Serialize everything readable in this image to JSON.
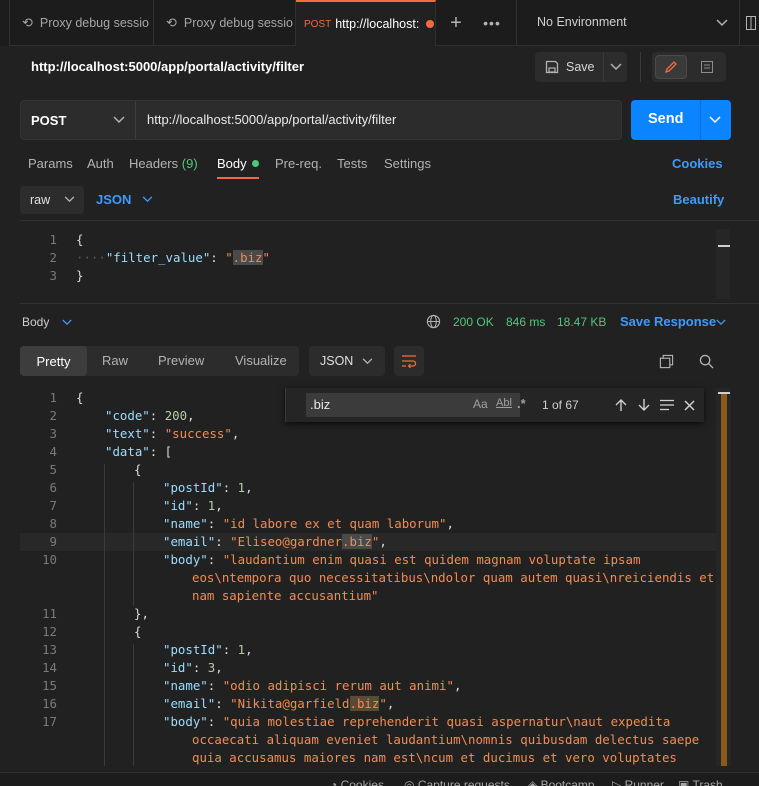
{
  "tabs": [
    {
      "label": "Proxy debug sessio"
    },
    {
      "label": "Proxy debug sessio"
    },
    {
      "method": "POST",
      "label": "http://localhost:"
    }
  ],
  "environment": "No Environment",
  "request_title": "http://localhost:5000/app/portal/activity/filter",
  "save_label": "Save",
  "method": "POST",
  "url": "http://localhost:5000/app/portal/activity/filter",
  "send_label": "Send",
  "req_tabs": {
    "params": "Params",
    "auth": "Auth",
    "headers": "Headers",
    "headers_count": "(9)",
    "body": "Body",
    "prereq": "Pre-req.",
    "tests": "Tests",
    "settings": "Settings",
    "cookies": "Cookies"
  },
  "body_mode": "raw",
  "body_lang": "JSON",
  "beautify": "Beautify",
  "request_body": {
    "l1": "1",
    "l2": "2",
    "l3": "3",
    "open": "{",
    "key": "\"filter_value\"",
    "colon": ": ",
    "val_q1": "\"",
    "val_match": ".biz",
    "val_q2": "\"",
    "close": "}"
  },
  "response_bar": {
    "label": "Body",
    "status": "200 OK",
    "time": "846 ms",
    "size": "18.47 KB",
    "save_response": "Save Response"
  },
  "view_tabs": {
    "pretty": "Pretty",
    "raw": "Raw",
    "preview": "Preview",
    "visualize": "Visualize"
  },
  "resp_lang": "JSON",
  "find": {
    "query": ".biz",
    "case": "Aa",
    "word": "Abl",
    "regex": ".*",
    "count": "1 of 67"
  },
  "response_lines": [
    {
      "n": "1",
      "indent": 0,
      "parts": [
        [
          "pun",
          "{"
        ]
      ]
    },
    {
      "n": "2",
      "indent": 1,
      "parts": [
        [
          "key",
          "\"code\""
        ],
        [
          "pun",
          ": "
        ],
        [
          "num",
          "200"
        ],
        [
          "pun",
          ","
        ]
      ]
    },
    {
      "n": "3",
      "indent": 1,
      "parts": [
        [
          "key",
          "\"text\""
        ],
        [
          "pun",
          ": "
        ],
        [
          "str",
          "\"success\""
        ],
        [
          "pun",
          ","
        ]
      ]
    },
    {
      "n": "4",
      "indent": 1,
      "parts": [
        [
          "key",
          "\"data\""
        ],
        [
          "pun",
          ": ["
        ]
      ]
    },
    {
      "n": "5",
      "indent": 2,
      "parts": [
        [
          "pun",
          "{"
        ]
      ]
    },
    {
      "n": "6",
      "indent": 3,
      "parts": [
        [
          "key",
          "\"postId\""
        ],
        [
          "pun",
          ": "
        ],
        [
          "num",
          "1"
        ],
        [
          "pun",
          ","
        ]
      ]
    },
    {
      "n": "7",
      "indent": 3,
      "parts": [
        [
          "key",
          "\"id\""
        ],
        [
          "pun",
          ": "
        ],
        [
          "num",
          "1"
        ],
        [
          "pun",
          ","
        ]
      ]
    },
    {
      "n": "8",
      "indent": 3,
      "parts": [
        [
          "key",
          "\"name\""
        ],
        [
          "pun",
          ": "
        ],
        [
          "str",
          "\"id labore ex et quam laborum\""
        ],
        [
          "pun",
          ","
        ]
      ]
    },
    {
      "n": "9",
      "indent": 3,
      "current": true,
      "parts": [
        [
          "key",
          "\"email\""
        ],
        [
          "pun",
          ": "
        ],
        [
          "str",
          "\"Eliseo@gardner"
        ],
        [
          "strhl",
          ".biz"
        ],
        [
          "str",
          "\""
        ],
        [
          "pun",
          ","
        ]
      ]
    },
    {
      "n": "10",
      "indent": 3,
      "parts": [
        [
          "key",
          "\"body\""
        ],
        [
          "pun",
          ": "
        ],
        [
          "str",
          "\"laudantium enim quasi est quidem magnam voluptate ipsam"
        ]
      ]
    },
    {
      "n": "",
      "indent": 4,
      "parts": [
        [
          "str",
          "eos\\ntempora quo necessitatibus\\ndolor quam autem quasi\\nreiciendis et"
        ]
      ]
    },
    {
      "n": "",
      "indent": 4,
      "parts": [
        [
          "str",
          "nam sapiente accusantium\""
        ]
      ]
    },
    {
      "n": "11",
      "indent": 2,
      "parts": [
        [
          "pun",
          "},"
        ]
      ]
    },
    {
      "n": "12",
      "indent": 2,
      "parts": [
        [
          "pun",
          "{"
        ]
      ]
    },
    {
      "n": "13",
      "indent": 3,
      "parts": [
        [
          "key",
          "\"postId\""
        ],
        [
          "pun",
          ": "
        ],
        [
          "num",
          "1"
        ],
        [
          "pun",
          ","
        ]
      ]
    },
    {
      "n": "14",
      "indent": 3,
      "parts": [
        [
          "key",
          "\"id\""
        ],
        [
          "pun",
          ": "
        ],
        [
          "num",
          "3"
        ],
        [
          "pun",
          ","
        ]
      ]
    },
    {
      "n": "15",
      "indent": 3,
      "parts": [
        [
          "key",
          "\"name\""
        ],
        [
          "pun",
          ": "
        ],
        [
          "str",
          "\"odio adipisci rerum aut animi\""
        ],
        [
          "pun",
          ","
        ]
      ]
    },
    {
      "n": "16",
      "indent": 3,
      "parts": [
        [
          "key",
          "\"email\""
        ],
        [
          "pun",
          ": "
        ],
        [
          "str",
          "\"Nikita@garfield"
        ],
        [
          "strhlm",
          ".biz"
        ],
        [
          "str",
          "\""
        ],
        [
          "pun",
          ","
        ]
      ]
    },
    {
      "n": "17",
      "indent": 3,
      "parts": [
        [
          "key",
          "\"body\""
        ],
        [
          "pun",
          ": "
        ],
        [
          "str",
          "\"quia molestiae reprehenderit quasi aspernatur\\naut expedita"
        ]
      ]
    },
    {
      "n": "",
      "indent": 4,
      "parts": [
        [
          "str",
          "occaecati aliquam eveniet laudantium\\nomnis quibusdam delectus saepe"
        ]
      ]
    },
    {
      "n": "",
      "indent": 4,
      "parts": [
        [
          "str",
          "quia accusamus maiores nam est\\ncum et ducimus et vero voluptates"
        ]
      ]
    }
  ],
  "statusbar": {
    "cookies": "Cookies",
    "capture": "Capture requests",
    "bootcamp": "Bootcamp",
    "runner": "Runner",
    "trash": "Trash"
  },
  "colors": {
    "accent": "#f26b3a",
    "send": "#0b84ff",
    "link": "#3d9bff",
    "ok": "#4ec97a",
    "string": "#f28b54",
    "key": "#9cdcfe"
  }
}
